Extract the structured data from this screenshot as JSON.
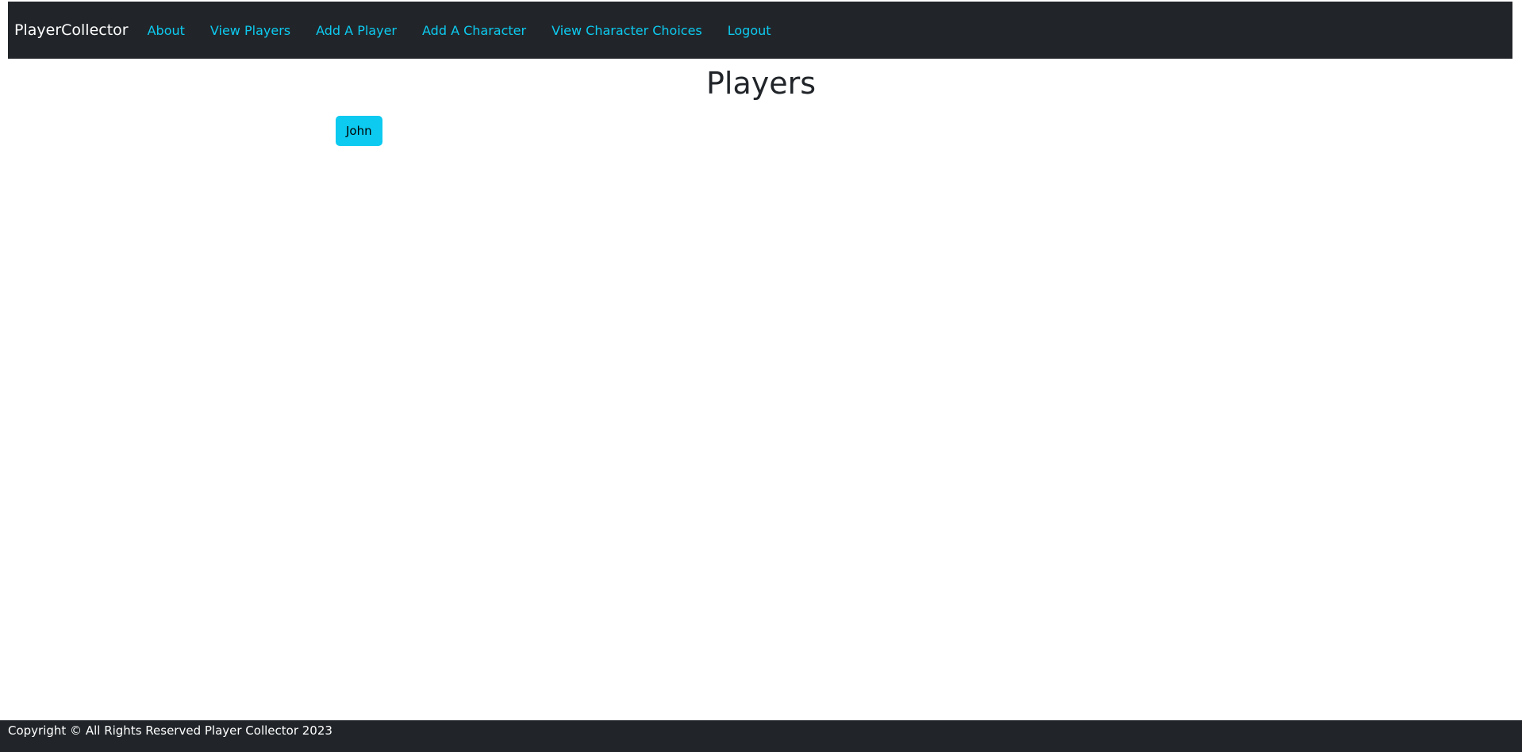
{
  "navbar": {
    "brand": "PlayerCollector",
    "links": [
      {
        "label": "About"
      },
      {
        "label": "View Players"
      },
      {
        "label": "Add A Player"
      },
      {
        "label": "Add A Character"
      },
      {
        "label": "View Character Choices"
      },
      {
        "label": "Logout"
      }
    ]
  },
  "main": {
    "title": "Players",
    "players": [
      {
        "name": "John"
      }
    ]
  },
  "footer": {
    "text": "Copyright © All Rights Reserved Player Collector 2023"
  },
  "colors": {
    "navbar_bg": "#212529",
    "link": "#0dcaf0",
    "button_bg": "#0dcaf0",
    "text": "#212529"
  }
}
